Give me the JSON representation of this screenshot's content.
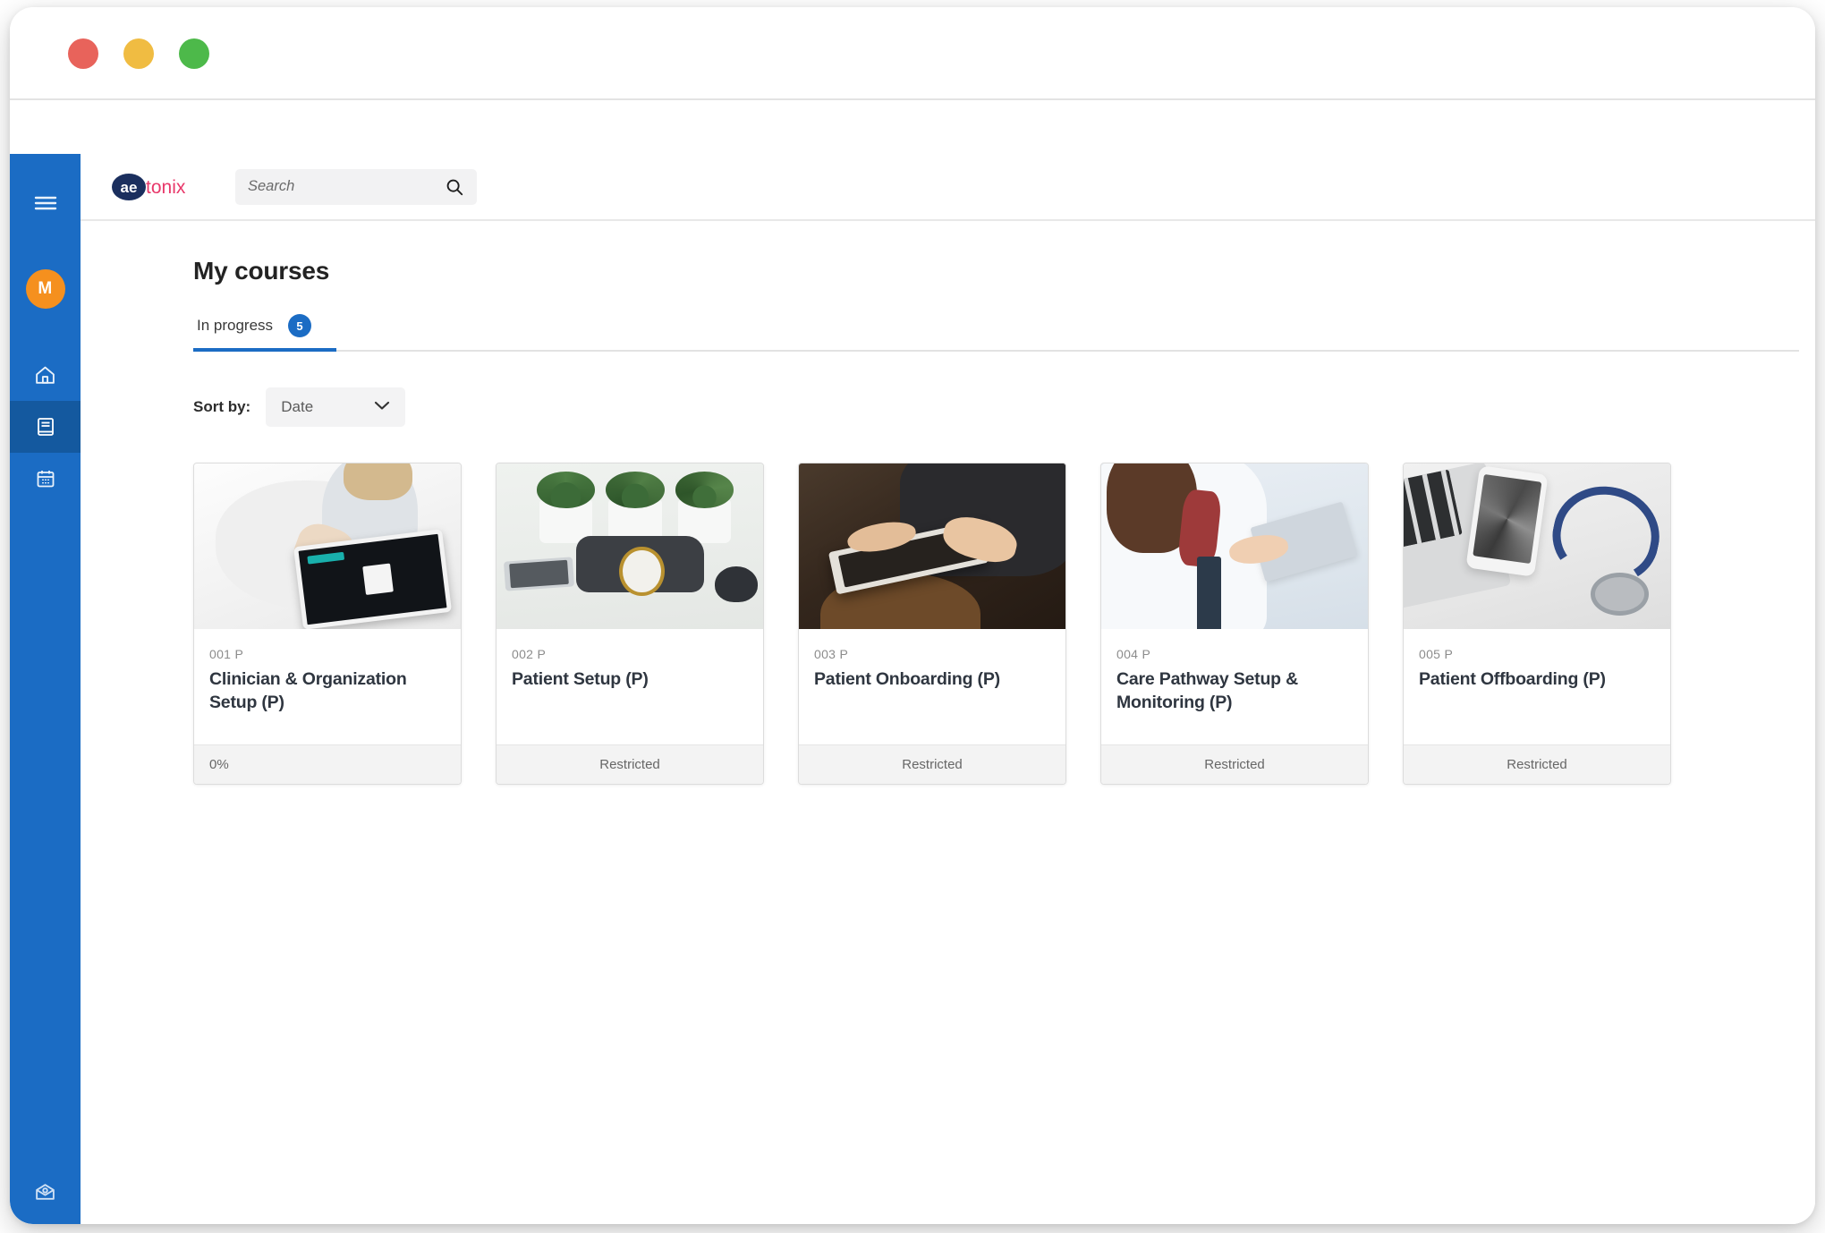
{
  "window": {
    "traffic_lights": [
      "close",
      "minimize",
      "zoom"
    ],
    "colors": {
      "close": "#e8635b",
      "minimize": "#f0bc42",
      "zoom": "#4db94a"
    }
  },
  "sidebar": {
    "accent": "#1b6cc4",
    "active_accent": "#14599f",
    "avatar": {
      "initial": "M",
      "color": "#f5901e"
    },
    "items": [
      {
        "name": "menu-toggle",
        "icon": "hamburger-icon",
        "active": false
      },
      {
        "name": "home",
        "icon": "home-icon",
        "active": false
      },
      {
        "name": "courses",
        "icon": "book-icon",
        "active": true
      },
      {
        "name": "calendar",
        "icon": "calendar-icon",
        "active": false
      },
      {
        "name": "messages",
        "icon": "inbox-icon",
        "active": false
      }
    ]
  },
  "topbar": {
    "logo": {
      "mark_text": "ae",
      "word_text": "tonix",
      "mark_color": "#1b2f5e",
      "word_color": "#e8386a"
    },
    "search": {
      "placeholder": "Search",
      "value": ""
    }
  },
  "main": {
    "page_title": "My courses",
    "tabs": [
      {
        "label": "In progress",
        "badge": "5",
        "active": true
      }
    ],
    "sort": {
      "label": "Sort by:",
      "value": "Date"
    }
  },
  "courses": [
    {
      "code": "001 P",
      "title": "Clinician & Organization Setup (P)",
      "status": "0%",
      "status_align": "left",
      "art": "a1",
      "image_alt": "clinician-with-tablet"
    },
    {
      "code": "002 P",
      "title": "Patient Setup (P)",
      "status": "Restricted",
      "status_align": "center",
      "art": "a2",
      "image_alt": "blood-pressure-cuff-and-plants"
    },
    {
      "code": "003 P",
      "title": "Patient Onboarding (P)",
      "status": "Restricted",
      "status_align": "center",
      "art": "a3",
      "image_alt": "hands-using-tablet"
    },
    {
      "code": "004 P",
      "title": "Care Pathway Setup & Monitoring (P)",
      "status": "Restricted",
      "status_align": "center",
      "art": "a4",
      "image_alt": "doctor-with-clipboard"
    },
    {
      "code": "005 P",
      "title": "Patient Offboarding (P)",
      "status": "Restricted",
      "status_align": "center",
      "art": "a5",
      "image_alt": "laptop-phone-stethoscope"
    }
  ]
}
